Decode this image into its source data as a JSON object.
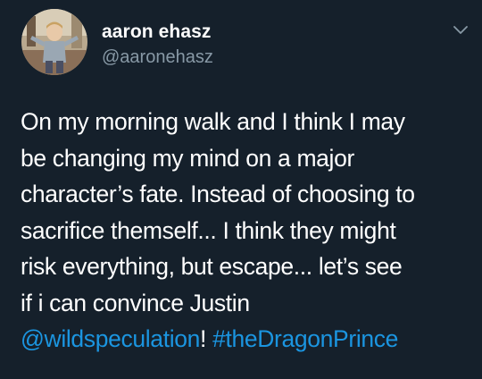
{
  "author": {
    "display_name": "aaron ehasz",
    "handle": "@aaronehasz",
    "avatar_icon": "profile-photo"
  },
  "menu_icon": "chevron-down-icon",
  "tweet": {
    "lines": [
      "On my morning walk and I think I may",
      "be changing my mind on a major",
      "character’s fate. Instead of choosing to",
      "sacrifice themself... I think they might",
      "risk everything, but escape... let’s see",
      "if i can convince Justin"
    ],
    "mention": "@wildspeculation",
    "after_mention": "! ",
    "hashtag": "#theDragonPrince"
  },
  "colors": {
    "background": "#15202b",
    "text": "#ffffff",
    "secondary": "#8899a6",
    "link": "#1b95e0"
  }
}
